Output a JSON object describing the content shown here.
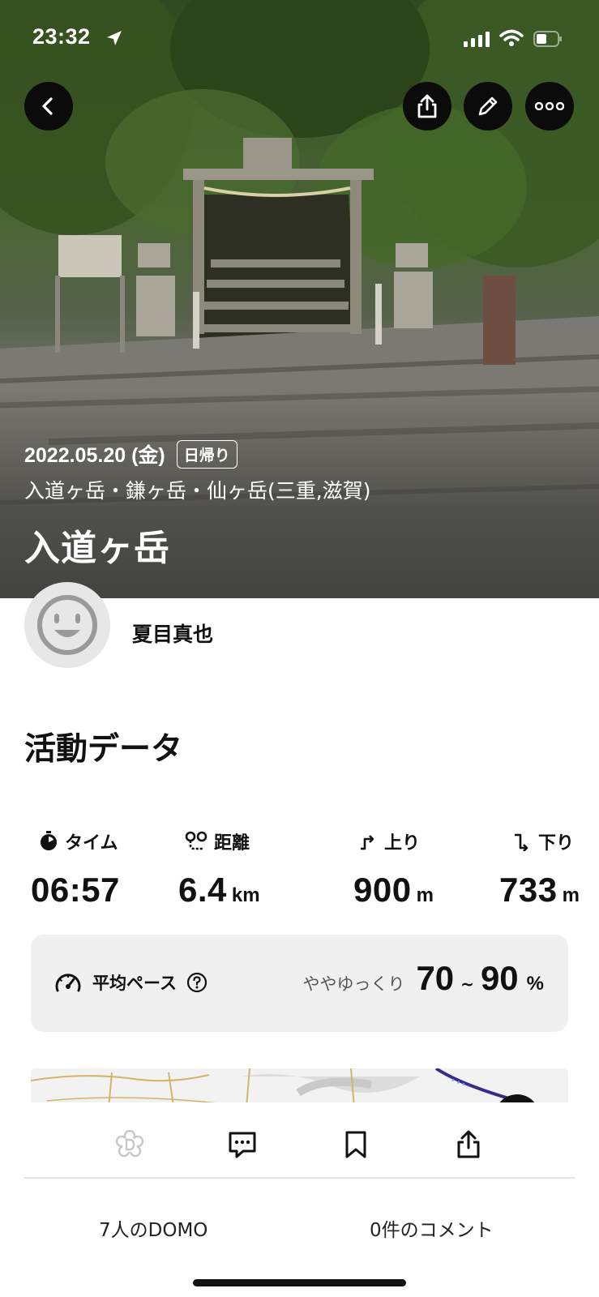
{
  "status_bar": {
    "time": "23:32"
  },
  "hero": {
    "date": "2022.05.20 (金)",
    "day_trip_badge": "日帰り",
    "area": "入道ヶ岳・鎌ヶ岳・仙ヶ岳(三重,滋賀)",
    "title": "入道ヶ岳"
  },
  "user": {
    "name": "夏目真也"
  },
  "activity": {
    "section_title": "活動データ",
    "stats": [
      {
        "label": "タイム",
        "value": "06:57",
        "unit": ""
      },
      {
        "label": "距離",
        "value": "6.4",
        "unit": "km"
      },
      {
        "label": "上り",
        "value": "900",
        "unit": "m"
      },
      {
        "label": "下り",
        "value": "733",
        "unit": "m"
      }
    ],
    "pace": {
      "label": "平均ペース",
      "description": "ややゆっくり",
      "min": "70",
      "tilde": "~",
      "max": "90",
      "unit": "%"
    }
  },
  "footer": {
    "domo_count": "7人のDOMO",
    "comment_count": "0件のコメント"
  },
  "icons": [
    "back-arrow-icon",
    "share-icon",
    "pencil-icon",
    "more-dots-icon",
    "stopwatch-icon",
    "route-distance-icon",
    "ascent-icon",
    "descent-icon",
    "speedometer-icon",
    "help-icon",
    "domo-flower-icon",
    "comment-icon",
    "bookmark-icon"
  ]
}
